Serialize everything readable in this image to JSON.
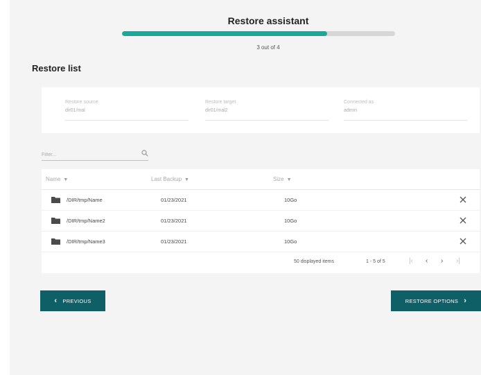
{
  "header": {
    "title": "Restore assistant",
    "step_text": "3 out of 4",
    "progress": 0.75
  },
  "section": {
    "title": "Restore list"
  },
  "info": [
    {
      "label": "Restore source",
      "value": "dir01/mal"
    },
    {
      "label": "Restore target",
      "value": "dir01/mal2"
    },
    {
      "label": "Connected as",
      "value": "admin"
    }
  ],
  "filter": {
    "placeholder": "Filter..."
  },
  "table": {
    "columns": [
      {
        "label": "Name"
      },
      {
        "label": "Last Backup"
      },
      {
        "label": "Size"
      }
    ],
    "rows": [
      {
        "name": "/DIR/tmp/Name",
        "last_backup": "01/23/2021",
        "size": "10Go"
      },
      {
        "name": "/DIR/tmp/Name2",
        "last_backup": "01/23/2021",
        "size": "10Go"
      },
      {
        "name": "/DIR/tmp/Name3",
        "last_backup": "01/23/2021",
        "size": "10Go"
      }
    ]
  },
  "pager": {
    "displayed": "50 displayed items",
    "range": "1 - 5 of 5"
  },
  "buttons": {
    "previous": "PREVIOUS",
    "next": "RESTORE OPTIONS"
  },
  "colors": {
    "accent": "#1aa89a",
    "button": "#0e5f66"
  }
}
